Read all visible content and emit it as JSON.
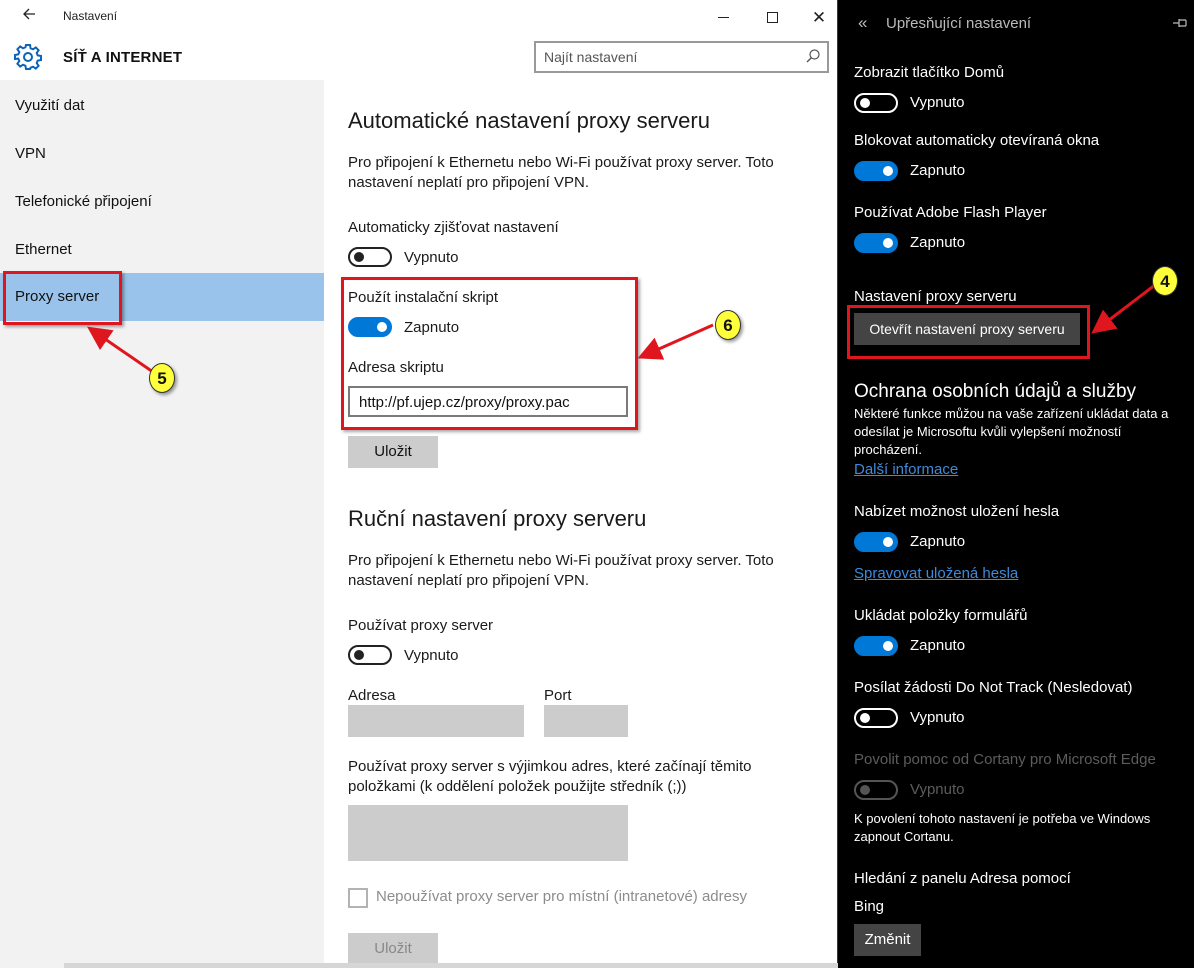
{
  "window": {
    "title": "Nastavení",
    "back_icon": "arrow-left-icon",
    "minimize_icon": "minimize-icon",
    "maximize_icon": "maximize-icon",
    "close_icon": "close-icon"
  },
  "header": {
    "section_title": "SÍŤ A INTERNET",
    "section_icon": "gear-icon",
    "search_placeholder": "Najít nastavení",
    "search_icon": "search-icon"
  },
  "nav": {
    "items": [
      {
        "label": "Využití dat",
        "selected": false
      },
      {
        "label": "VPN",
        "selected": false
      },
      {
        "label": "Telefonické připojení",
        "selected": false
      },
      {
        "label": "Ethernet",
        "selected": false
      },
      {
        "label": "Proxy server",
        "selected": true
      }
    ]
  },
  "auto_proxy": {
    "heading": "Automatické nastavení proxy serveru",
    "description_line1": "Pro připojení k Ethernetu nebo Wi-Fi používat proxy server. Toto",
    "description_line2": "nastavení neplatí pro připojení VPN.",
    "detect_label": "Automaticky zjišťovat nastavení",
    "detect_state": "Vypnuto",
    "script_label": "Použít instalační skript",
    "script_state": "Zapnuto",
    "address_label": "Adresa skriptu",
    "address_value": "http://pf.ujep.cz/proxy/proxy.pac",
    "save_label": "Uložit"
  },
  "manual_proxy": {
    "heading": "Ruční nastavení proxy serveru",
    "description_line1": "Pro připojení k Ethernetu nebo Wi-Fi používat proxy server. Toto",
    "description_line2": "nastavení neplatí pro připojení VPN.",
    "use_label": "Používat proxy server",
    "use_state": "Vypnuto",
    "address_label": "Adresa",
    "port_label": "Port",
    "exceptions_line1": "Používat proxy server s výjimkou adres, které začínají těmito",
    "exceptions_line2": "položkami (k oddělení položek použijte středník (;))",
    "local_label": "Nepoužívat proxy server pro místní (intranetové) adresy",
    "save_label": "Uložit"
  },
  "flyout": {
    "title": "Upřesňující nastavení",
    "back_icon": "double-chevron-left-icon",
    "pin_icon": "pin-icon",
    "home_label": "Zobrazit tlačítko Domů",
    "home_state": "Vypnuto",
    "popups_label": "Blokovat automaticky otevíraná okna",
    "popups_state": "Zapnuto",
    "flash_label": "Používat Adobe Flash Player",
    "flash_state": "Zapnuto",
    "proxy_label": "Nastavení proxy serveru",
    "proxy_button": "Otevřít nastavení proxy serveru",
    "privacy_heading": "Ochrana osobních údajů a služby",
    "privacy_line1": "Některé funkce můžou na vaše zařízení ukládat data a",
    "privacy_line2": "odesílat je Microsoftu kvůli vylepšení možností",
    "privacy_line3": "procházení.",
    "more_info_link": "Další informace",
    "passwords_label": "Nabízet možnost uložení hesla",
    "passwords_state": "Zapnuto",
    "manage_passwords_link": "Spravovat uložená hesla",
    "forms_label": "Ukládat položky formulářů",
    "forms_state": "Zapnuto",
    "dnt_label": "Posílat žádosti Do Not Track (Nesledovat)",
    "dnt_state": "Vypnuto",
    "cortana_label": "Povolit pomoc od Cortany pro Microsoft Edge",
    "cortana_state": "Vypnuto",
    "cortana_note_line1": "K povolení tohoto nastavení je potřeba ve Windows",
    "cortana_note_line2": "zapnout Cortanu.",
    "search_label": "Hledání z panelu Adresa pomocí",
    "search_engine": "Bing",
    "change_button": "Změnit"
  },
  "annotations": {
    "badge_4": "4",
    "badge_5": "5",
    "badge_6": "6",
    "highlight_color": "#e0161f",
    "badge_color": "#ffff3a"
  },
  "colors": {
    "accent": "#0078d7",
    "nav_selected": "#99c3ea",
    "link": "#3f8ad8"
  }
}
